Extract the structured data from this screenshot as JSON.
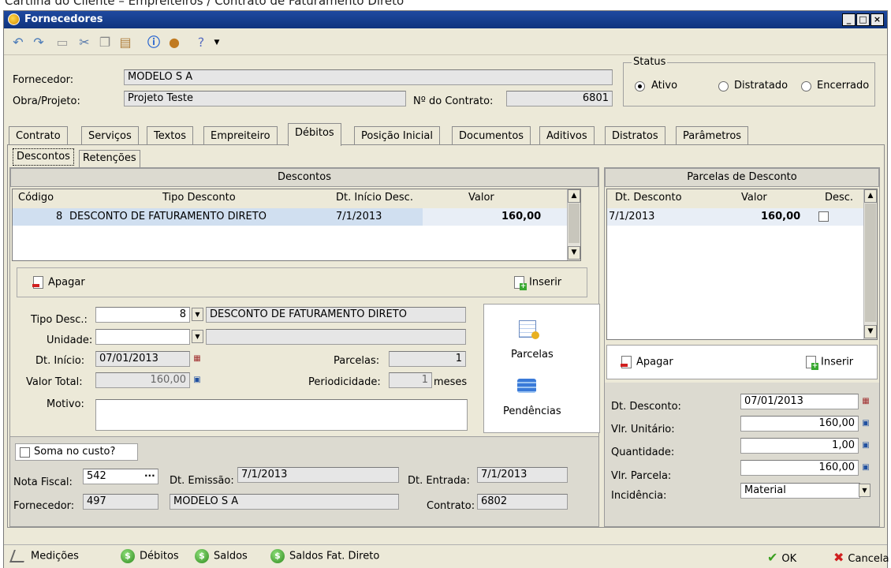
{
  "page_caption": "Cartilha do Cliente – Empreiteiros / Contrato de Faturamento Direto",
  "window": {
    "title": "Fornecedores"
  },
  "header": {
    "fornecedor_label": "Fornecedor:",
    "fornecedor_value": "MODELO S A",
    "obra_label": "Obra/Projeto:",
    "obra_value": "Projeto Teste",
    "contrato_label": "Nº do Contrato:",
    "contrato_value": "6801",
    "status": {
      "title": "Status",
      "options": [
        {
          "label": "Ativo",
          "selected": true
        },
        {
          "label": "Distratado",
          "selected": false
        },
        {
          "label": "Encerrado",
          "selected": false
        }
      ]
    }
  },
  "tabs": [
    {
      "label": "Contrato",
      "active": false
    },
    {
      "label": "Serviços",
      "active": false
    },
    {
      "label": "Textos",
      "active": false
    },
    {
      "label": "Empreiteiro",
      "active": false
    },
    {
      "label": "Débitos",
      "active": true
    },
    {
      "label": "Posição Inicial",
      "active": false
    },
    {
      "label": "Documentos",
      "active": false
    },
    {
      "label": "Aditivos",
      "active": false
    },
    {
      "label": "Distratos",
      "active": false
    },
    {
      "label": "Parâmetros",
      "active": false
    }
  ],
  "subtabs": [
    {
      "label": "Descontos",
      "active": true
    },
    {
      "label": "Retenções",
      "active": false
    }
  ],
  "descontos": {
    "title": "Descontos",
    "columns": [
      "Código",
      "Tipo Desconto",
      "Dt. Início Desc.",
      "Valor"
    ],
    "rows": [
      {
        "codigo": "8",
        "tipo": "DESCONTO DE FATURAMENTO DIRETO",
        "inicio": "7/1/2013",
        "valor": "160,00"
      }
    ],
    "apagar_label": "Apagar",
    "inserir_label": "Inserir"
  },
  "form": {
    "tipo_label": "Tipo Desc.:",
    "tipo_code": "8",
    "tipo_desc": "DESCONTO DE FATURAMENTO DIRETO",
    "unidade_label": "Unidade:",
    "dt_inicio_label": "Dt. Início:",
    "dt_inicio_value": "07/01/2013",
    "parcelas_label": "Parcelas:",
    "parcelas_value": "1",
    "valor_total_label": "Valor Total:",
    "valor_total_value": "160,00",
    "periodicidade_label": "Periodicidade:",
    "periodicidade_value": "1",
    "periodicidade_unit": "meses",
    "motivo_label": "Motivo:",
    "parcelas_button": "Parcelas",
    "pendencias_button": "Pendências"
  },
  "nota": {
    "soma_label": "Soma no custo?",
    "nota_fiscal_label": "Nota Fiscal:",
    "nota_fiscal_value": "542",
    "dt_emissao_label": "Dt. Emissão:",
    "dt_emissao_value": "7/1/2013",
    "dt_entrada_label": "Dt. Entrada:",
    "dt_entrada_value": "7/1/2013",
    "fornecedor_label": "Fornecedor:",
    "fornecedor_code": "497",
    "fornecedor_name": "MODELO S A",
    "contrato_label": "Contrato:",
    "contrato_value": "6802"
  },
  "parcelas": {
    "title": "Parcelas de Desconto",
    "columns": [
      "Dt. Desconto",
      "Valor",
      "Desc."
    ],
    "rows": [
      {
        "data": "7/1/2013",
        "valor": "160,00"
      }
    ],
    "apagar_label": "Apagar",
    "inserir_label": "Inserir",
    "dt_desconto_label": "Dt. Desconto:",
    "dt_desconto_value": "07/01/2013",
    "vlr_unitario_label": "Vlr. Unitário:",
    "vlr_unitario_value": "160,00",
    "quantidade_label": "Quantidade:",
    "quantidade_value": "1,00",
    "vlr_parcela_label": "Vlr. Parcela:",
    "vlr_parcela_value": "160,00",
    "incidencia_label": "Incidência:",
    "incidencia_value": "Material"
  },
  "footer": {
    "medicoes": "Medições",
    "debitos": "Débitos",
    "saldos": "Saldos",
    "saldos_fat": "Saldos Fat. Direto",
    "ok": "OK",
    "cancelar": "Cancela"
  }
}
